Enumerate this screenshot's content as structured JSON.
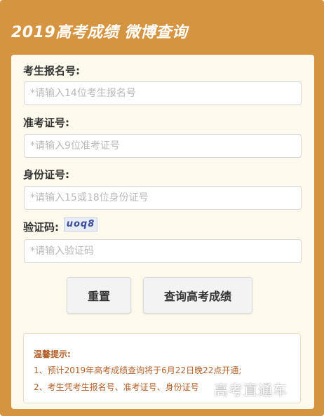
{
  "header": {
    "title": "2019高考成绩 微博查询"
  },
  "form": {
    "exam_no": {
      "label": "考生报名号:",
      "placeholder": "*请输入14位考生报名号"
    },
    "admission_no": {
      "label": "准考证号:",
      "placeholder": "*请输入9位准考证号"
    },
    "id_no": {
      "label": "身份证号:",
      "placeholder": "*请输入15或18位身份证号"
    },
    "captcha": {
      "label": "验证码:",
      "image_text": "uoq8",
      "placeholder": "*请输入验证码"
    }
  },
  "buttons": {
    "reset_label": "重置",
    "query_label": "查询高考成绩"
  },
  "tips": {
    "title": "温馨提示:",
    "items": [
      "1、预计2019年高考成绩查询将于6月22日晚22点开通;",
      "2、考生凭考生报名号、准考证号、身份证号"
    ]
  },
  "watermark": "高考直通车",
  "colors": {
    "frame": "#d59440",
    "panel": "#fdf9ec",
    "tip_text": "#b5612a"
  }
}
